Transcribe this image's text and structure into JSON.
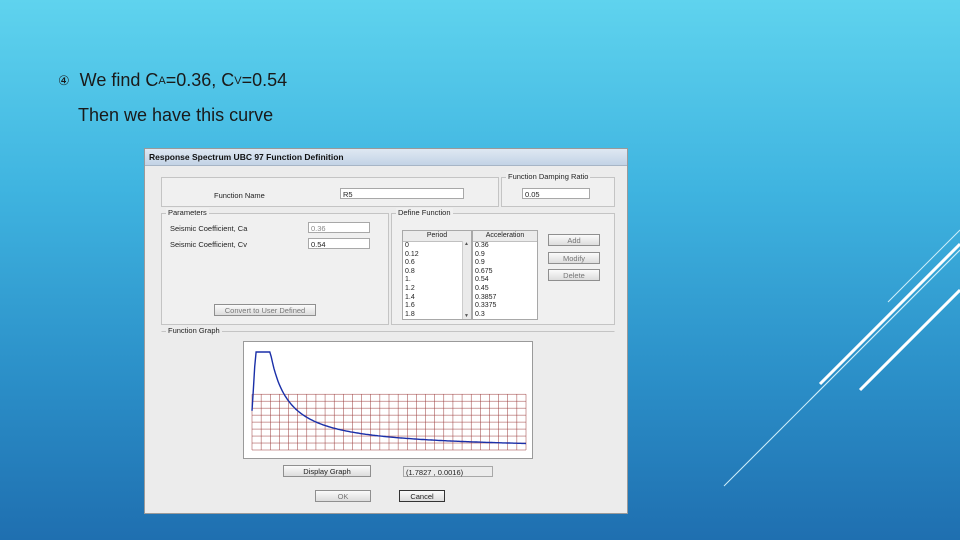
{
  "slide": {
    "bullet_mark": "④",
    "line1_prefix": "We find C",
    "line1_sub_a": "A",
    "line1_mid": "=0.36, C",
    "line1_sub_v": "V",
    "line1_suffix": "=0.54",
    "line2": "Then we have this curve"
  },
  "dialog": {
    "title": "Response Spectrum UBC 97 Function Definition",
    "function_name_label": "Function Name",
    "function_name_value": "R5",
    "damping_legend": "Function Damping Ratio",
    "damping_value": "0.05",
    "parameters_legend": "Parameters",
    "ca_label": "Seismic Coefficient, Ca",
    "ca_value": "0.36",
    "cv_label": "Seismic Coefficient, Cv",
    "cv_value": "0.54",
    "convert_button": "Convert to User Defined",
    "define_function_legend": "Define Function",
    "period_header": "Period",
    "accel_header": "Acceleration",
    "periods": [
      "0",
      "0.12",
      "0.6",
      "0.8",
      "1.",
      "1.2",
      "1.4",
      "1.6",
      "1.8"
    ],
    "accels": [
      "0.36",
      "0.9",
      "0.9",
      "0.675",
      "0.54",
      "0.45",
      "0.3857",
      "0.3375",
      "0.3"
    ],
    "add_button": "Add",
    "modify_button": "Modify",
    "delete_button": "Delete",
    "graph_legend": "Function Graph",
    "display_graph_button": "Display Graph",
    "coord_readout": "(1.7827 , 0.0016)",
    "ok_button": "OK",
    "cancel_button": "Cancel"
  },
  "colors": {
    "bg_top": "#5fd3ee",
    "bg_bottom": "#1f6fb0",
    "curve": "#1a2fa8",
    "grid": "#9a3a3a"
  }
}
